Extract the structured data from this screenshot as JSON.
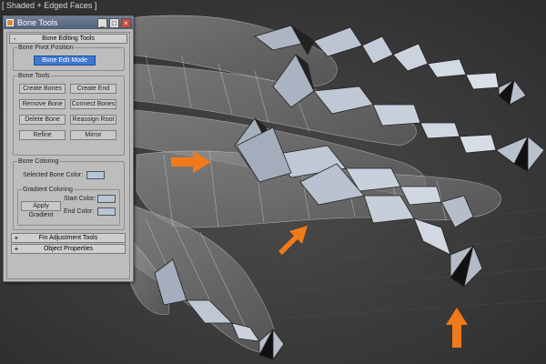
{
  "viewport": {
    "label": "[ Shaded + Edged Faces ]"
  },
  "window": {
    "title": "Bone Tools",
    "controls": {
      "minimize": "_",
      "maximize": "□",
      "close": "×"
    }
  },
  "rollouts": {
    "bone_editing": {
      "sign": "-",
      "title": "Bone Editing Tools"
    },
    "fin_adjustment": {
      "sign": "+",
      "title": "Fin Adjustment Tools"
    },
    "object_properties": {
      "sign": "+",
      "title": "Object Properties"
    }
  },
  "pivot_group": {
    "title": "Bone Pivot Position",
    "edit_mode": "Bone Edit Mode"
  },
  "tools_group": {
    "title": "Bone Tools",
    "create_bones": "Create Bones",
    "create_end": "Create End",
    "remove_bone": "Remove Bone",
    "connect_bones": "Connect Bones",
    "delete_bone": "Delete Bone",
    "reassign_root": "Reassign Root",
    "refine": "Refine",
    "mirror": "Mirror"
  },
  "coloring_group": {
    "title": "Bone Coloring",
    "selected_color_label": "Selected Bone Color:",
    "gradient_title": "Gradient Coloring",
    "apply_gradient": "Apply Gradient",
    "start_color_label": "Start Color:",
    "end_color_label": "End Color:"
  },
  "colors": {
    "accent": "#3f78d4",
    "arrow": "#f07a1a",
    "bone": "#b0b8c8",
    "swatch": "#b7c6d6"
  },
  "icons": {
    "window_icon": "bone-tools-icon",
    "arrows": "orange-arrow-icon"
  }
}
